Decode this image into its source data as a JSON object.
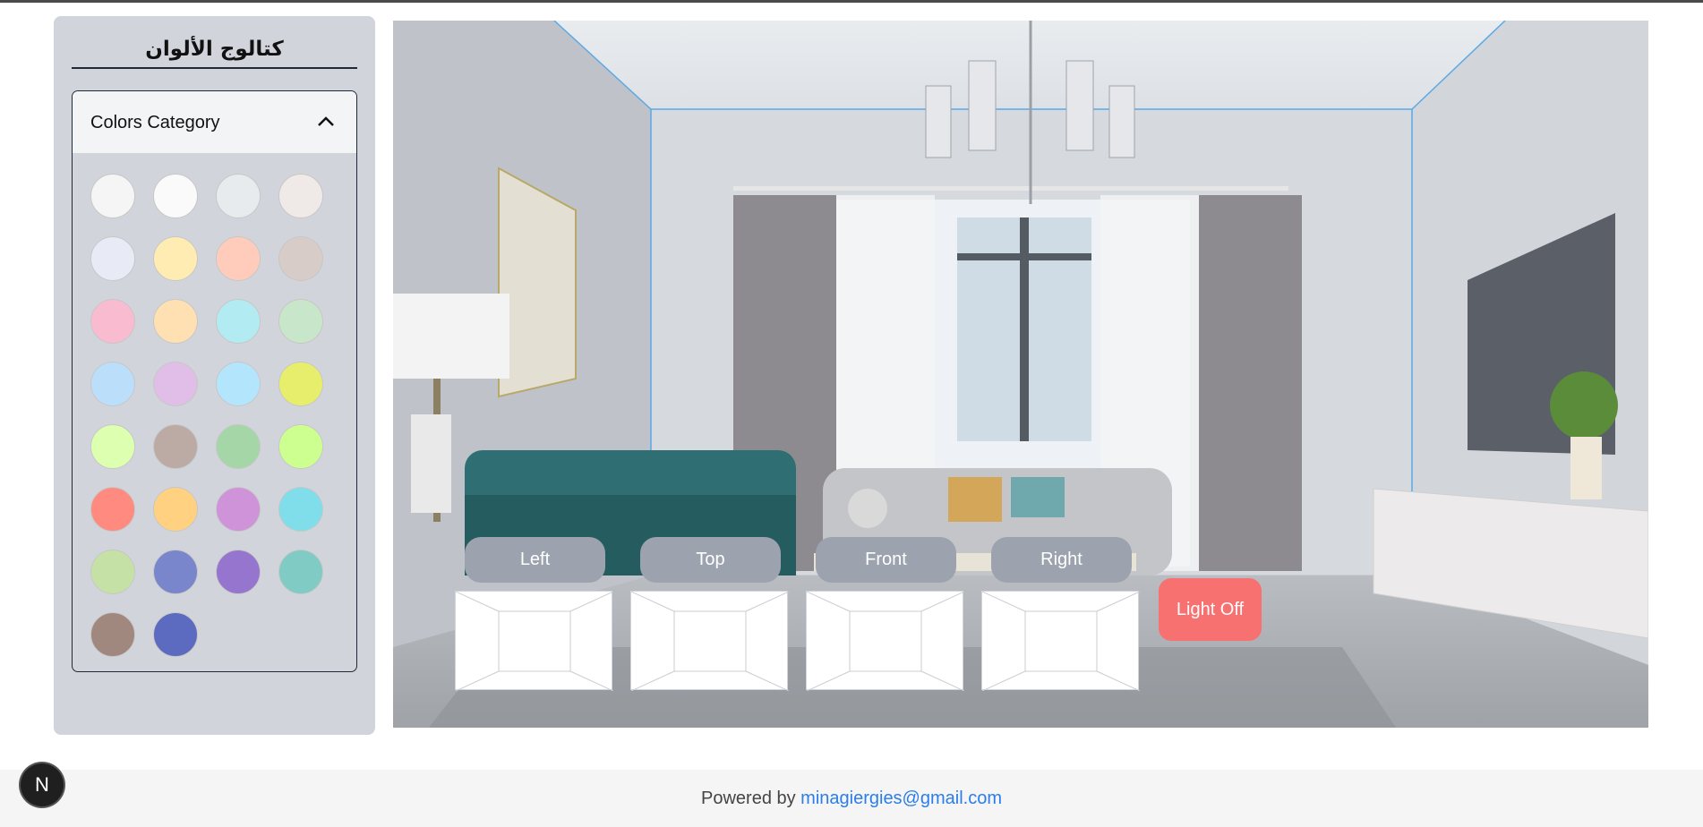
{
  "sidebar": {
    "title": "كتالوج الألوان",
    "category_label": "Colors Category",
    "swatches": [
      "#f5f5f5",
      "#fafafa",
      "#e8ebee",
      "#efe9e7",
      "#e8eaf6",
      "#ffecb3",
      "#ffccbc",
      "#d7ccc8",
      "#f8bbd0",
      "#ffe0b2",
      "#b2ebf2",
      "#c8e6c9",
      "#bbdefb",
      "#e1bee7",
      "#b3e5fc",
      "#e6ee6c",
      "#dcffb0",
      "#bcaaa4",
      "#a5d6a7",
      "#ccff90",
      "#ff8a80",
      "#ffd180",
      "#ce93d8",
      "#80deea",
      "#c5e1a5",
      "#7986cb",
      "#9575cd",
      "#80cbc4",
      "#a1887f",
      "#5c6bc0"
    ]
  },
  "views": {
    "left_label": "Left",
    "top_label": "Top",
    "front_label": "Front",
    "right_label": "Right"
  },
  "light_button_label": "Light Off",
  "footer": {
    "prefix": "Powered by",
    "email": "minagiergies@gmail.com"
  },
  "badge_letter": "N"
}
